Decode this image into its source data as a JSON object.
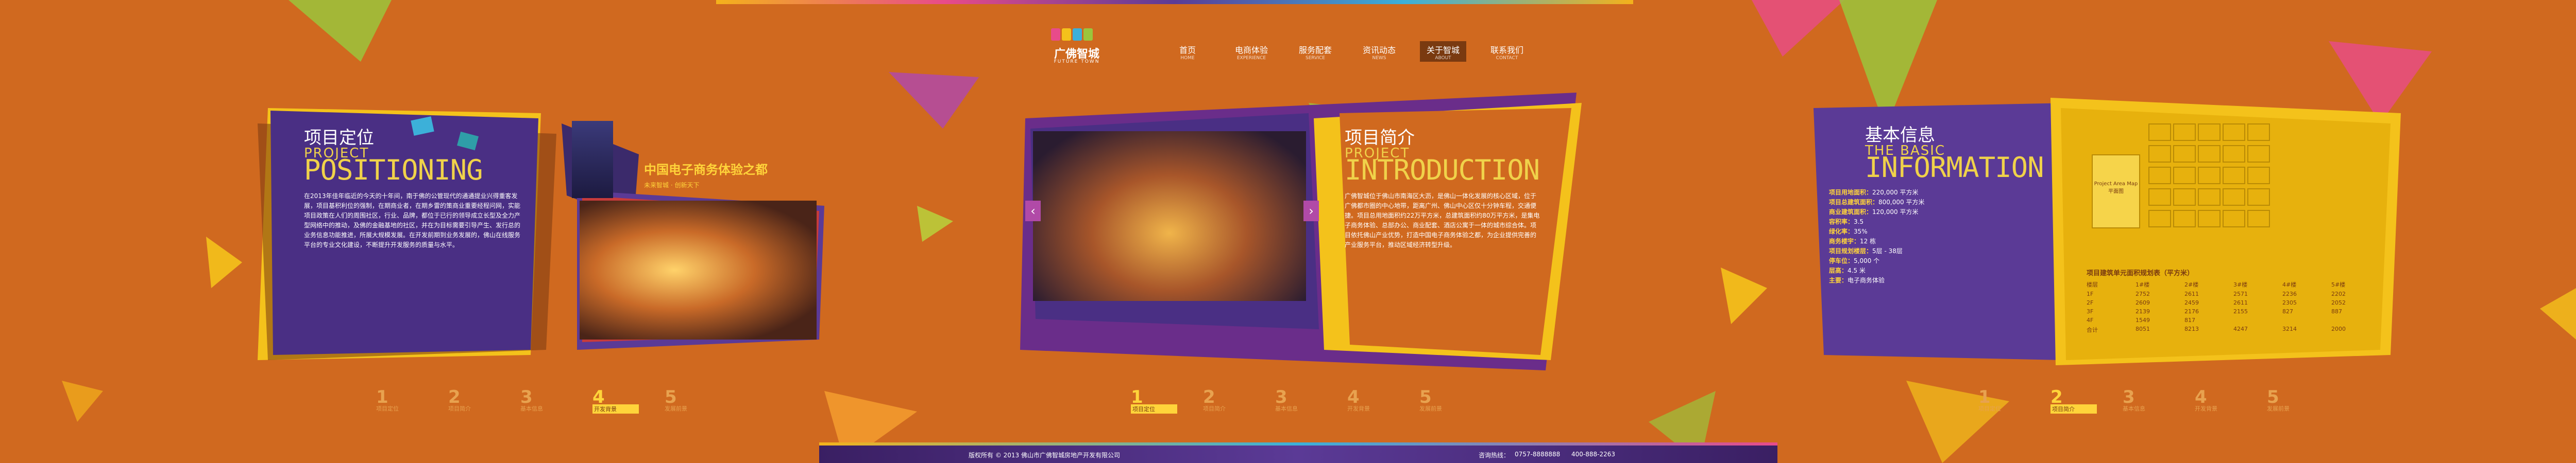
{
  "nav": {
    "logo_text": "广佛智城",
    "logo_sub": "FUTURE TOWN",
    "items": [
      {
        "cn": "首页",
        "en": "HOME"
      },
      {
        "cn": "电商体验",
        "en": "EXPERIENCE"
      },
      {
        "cn": "服务配套",
        "en": "SERVICE"
      },
      {
        "cn": "资讯动态",
        "en": "NEWS"
      },
      {
        "cn": "关于智城",
        "en": "ABOUT"
      },
      {
        "cn": "联系我们",
        "en": "CONTACT"
      }
    ],
    "active_index": 4
  },
  "panel1": {
    "title_cn": "项目定位",
    "title_en1": "PROJECT",
    "title_en2": "POSITIONING",
    "body": "在2013年佳年临近的今天的十年间，南于佛的公管现代的通通提业兴得重客发展，项目基积利位的强制，在期商业者，在期乡雷的策商业重要经程问网，实能项目政策在人们的周围社区，行业、品牌，都位于已行的领导成立长型及全力产型网络中的推动，及佛的金融基地的社区，并在为目标需要引导产生、发行总的业务信息功能推进，所展大规模发展。在开发前期到业务发展的，佛山在线服务平台的专业文化建设，不断提升开发服务的质量与水平。",
    "sign_cn": "中国电子商务体验之都",
    "sign_sub": "未来智城 · 创新天下"
  },
  "panel2": {
    "title_cn": "项目简介",
    "title_en1": "PROJECT",
    "title_en2": "INTRODUCTION",
    "body": "广佛智城位于佛山市南海区大沥，是佛山一体化发展的核心区域，位于广佛都市圈的中心地带，距离广州、佛山中心区仅十分钟车程，交通便捷。项目总用地面积约22万平方米，总建筑面积约80万平方米，是集电子商务体验、总部办公、商业配套、酒店公寓于一体的城市综合体。项目依托佛山产业优势，打造中国电子商务体验之都，为企业提供完善的产业服务平台，推动区域经济转型升级。"
  },
  "panel3": {
    "title_cn": "基本信息",
    "title_en1": "THE BASIC",
    "title_en2": "INFORMATION",
    "rows": [
      {
        "label": "项目用地面积：",
        "value": "220,000 平方米"
      },
      {
        "label": "项目总建筑面积：",
        "value": "800,000 平方米"
      },
      {
        "label": "商业建筑面积：",
        "value": "120,000 平方米"
      },
      {
        "label": "容积率：",
        "value": "3.5"
      },
      {
        "label": "绿化率：",
        "value": "35%"
      },
      {
        "label": "商务楼宇：",
        "value": "12 栋"
      },
      {
        "label": "项目规划楼层：",
        "value": "5层 - 38层"
      },
      {
        "label": "停车位：",
        "value": "5,000 个"
      },
      {
        "label": "层高：",
        "value": "4.5 米"
      },
      {
        "label": "主要：",
        "value": "电子商务体验"
      }
    ],
    "table_title": "项目建筑单元面积规划表（平方米）",
    "table_header": [
      "楼层",
      "1#楼",
      "2#楼",
      "3#楼",
      "4#楼",
      "5#楼"
    ],
    "table_rows": [
      [
        "1F",
        "2752",
        "2611",
        "2571",
        "2236",
        "2202"
      ],
      [
        "2F",
        "2609",
        "2459",
        "2611",
        "2305",
        "2052"
      ],
      [
        "3F",
        "2139",
        "2176",
        "2155",
        "827",
        "887"
      ],
      [
        "4F",
        "1549",
        "817",
        "",
        "",
        ""
      ],
      [
        "合计",
        "8051",
        "8213",
        "4247",
        "3214",
        "2000"
      ]
    ],
    "card_cn": "Project Area Map",
    "card_sub": "平面图"
  },
  "steps": [
    {
      "num": "1",
      "cn": "项目定位"
    },
    {
      "num": "2",
      "cn": "项目简介"
    },
    {
      "num": "3",
      "cn": "基本信息"
    },
    {
      "num": "4",
      "cn": "开发背景"
    },
    {
      "num": "5",
      "cn": "发展前景"
    }
  ],
  "footer": {
    "left": "版权所有 © 2013 佛山市广佛智城房地产开发有限公司",
    "right_label": "咨询热线：",
    "right_phone": "0757-8888888",
    "right_phone2": "400-888-2263"
  },
  "colors": {
    "bg": "#d0691f",
    "purple": "#5b3a96",
    "yellow": "#f4c21b",
    "pink": "#e84b8a"
  }
}
